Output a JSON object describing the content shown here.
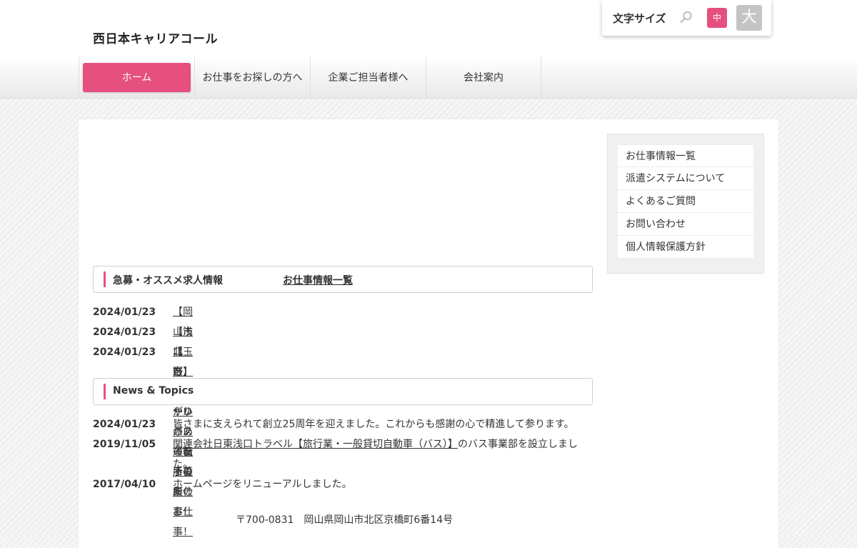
{
  "header": {
    "site_title": "西日本キャリアコール",
    "font_size": {
      "label": "文字サイズ",
      "medium": "中",
      "large": "大"
    }
  },
  "nav": [
    "ホーム",
    "お仕事をお探しの方へ",
    "企業ご担当者様へ",
    "会社案内"
  ],
  "jobs": {
    "title": "急募・オススメ求人情報",
    "link": "お仕事情報一覧",
    "items": [
      {
        "date": "2024/01/23",
        "text": "【岡山市北区】やりがいのある役所のお仕事！"
      },
      {
        "date": "2024/01/23",
        "text": "【浅口市】スクールバス運転手募集"
      },
      {
        "date": "2024/01/23",
        "text": "【玉野市】やりがいのある役所のお仕事！"
      }
    ]
  },
  "news": {
    "title": "News & Topics",
    "items": [
      {
        "date": "2024/01/23",
        "text": "皆さまに支えられて創立25周年を迎えました。これからも感謝の心で精進して参ります。"
      },
      {
        "date": "2019/11/05",
        "text_link": "関連会社日東浅口トラベル【旅行業・一般貸切自動車（バス）】",
        "text_rest": "のバス事業部を設立しました。"
      },
      {
        "date": "2017/04/10",
        "text": "ホームページをリニューアルしました。"
      }
    ]
  },
  "sidebar": [
    "お仕事情報一覧",
    "派遣システムについて",
    "よくあるご質問",
    "お問い合わせ",
    "個人情報保護方針"
  ],
  "footer": {
    "address": "〒700-0831　岡山県岡山市北区京橋町6番14号"
  },
  "colors": {
    "accent": "#e5507f",
    "large_button": "#c4c4c4"
  }
}
